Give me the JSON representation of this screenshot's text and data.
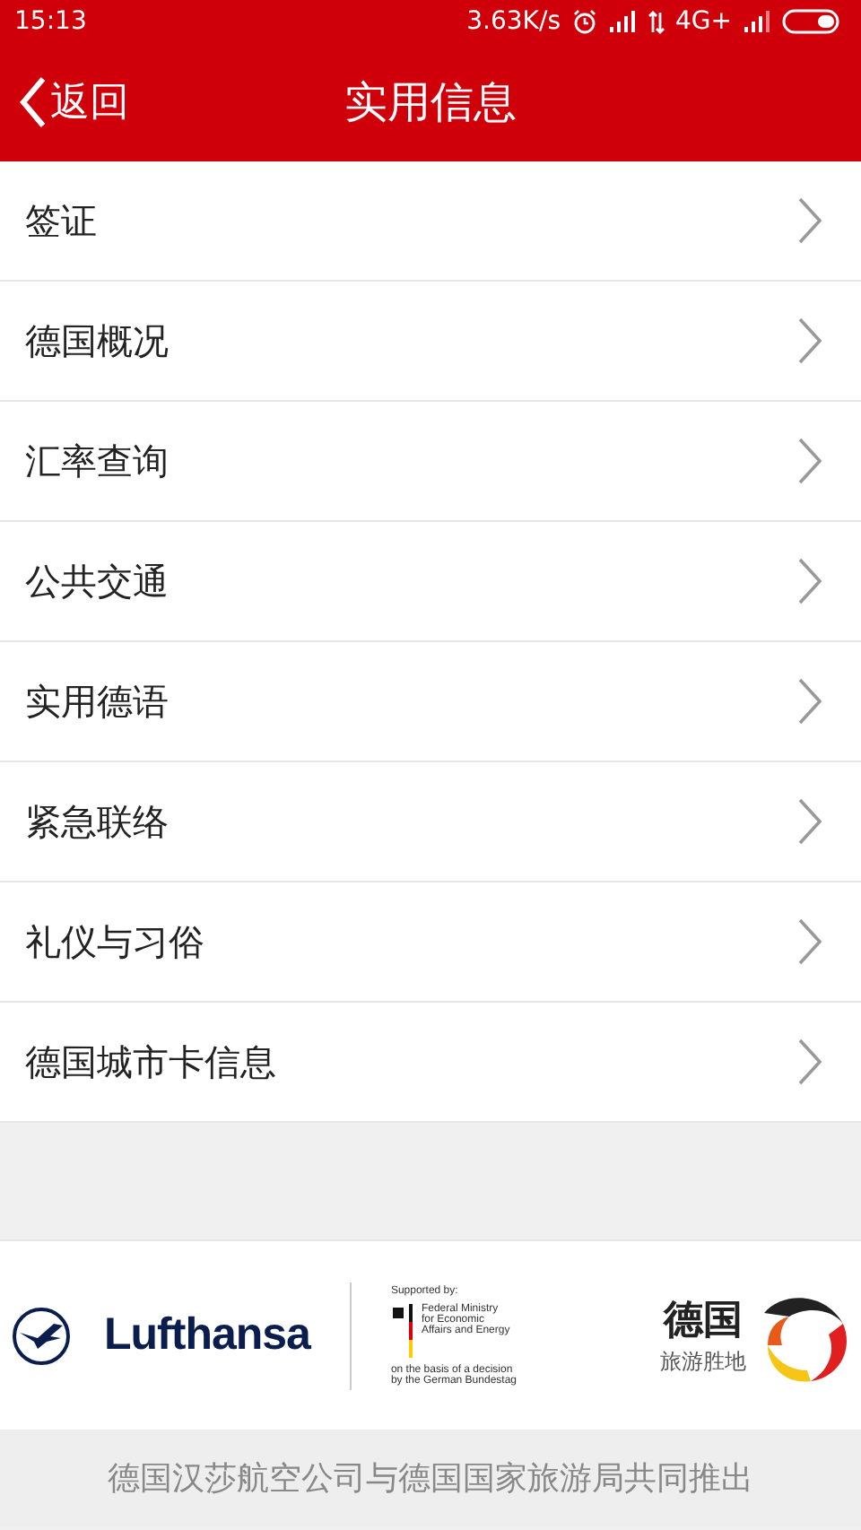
{
  "status_bar": {
    "time": "15:13",
    "speed": "3.63K/s",
    "network": "4G+"
  },
  "header": {
    "back": "返回",
    "title": "实用信息"
  },
  "menu_items": [
    {
      "label": "签证"
    },
    {
      "label": "德国概况"
    },
    {
      "label": "汇率查询"
    },
    {
      "label": "公共交通"
    },
    {
      "label": "实用德语"
    },
    {
      "label": "紧急联络"
    },
    {
      "label": "礼仪与习俗"
    },
    {
      "label": "德国城市卡信息"
    }
  ],
  "sponsors": {
    "airline": "Lufthansa",
    "supported_by": "Supported by:",
    "ministry": "Federal Ministry for Economic Affairs and Energy",
    "basis": "on the basis of a decision by the German Bundestag",
    "tourism_title": "德国",
    "tourism_subtitle": "旅游胜地"
  },
  "footer": "德国汉莎航空公司与德国国家旅游局共同推出"
}
